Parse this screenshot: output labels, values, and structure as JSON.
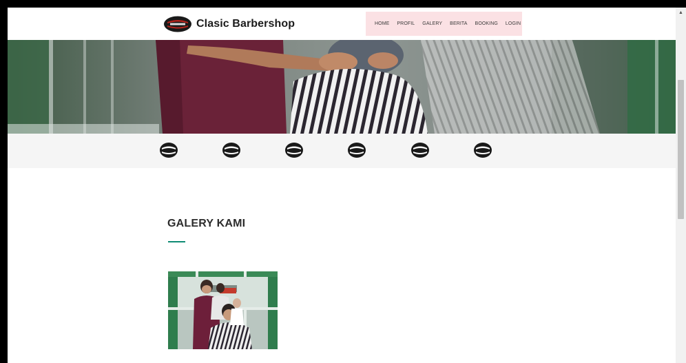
{
  "header": {
    "brand_name": "Clasic Barbershop",
    "nav_items": [
      {
        "label": "HOME"
      },
      {
        "label": "PROFIL"
      },
      {
        "label": "GALERY"
      },
      {
        "label": "BERITA"
      },
      {
        "label": "BOOKING"
      },
      {
        "label": "LOGIN"
      }
    ]
  },
  "gallery": {
    "title": "GALERY KAMI"
  },
  "colors": {
    "accent": "#0e8a73",
    "nav_background": "#fbe1e4",
    "logo_strip_background": "#f5f5f5",
    "logo_dark": "#1a1a1a",
    "logo_red": "#b5241c"
  },
  "icons": {
    "brand_logo": "classic-barbershop-logo-icon",
    "partner_logo": "classic-barbershop-logo-icon",
    "scroll_up": "triangle-up-icon"
  }
}
